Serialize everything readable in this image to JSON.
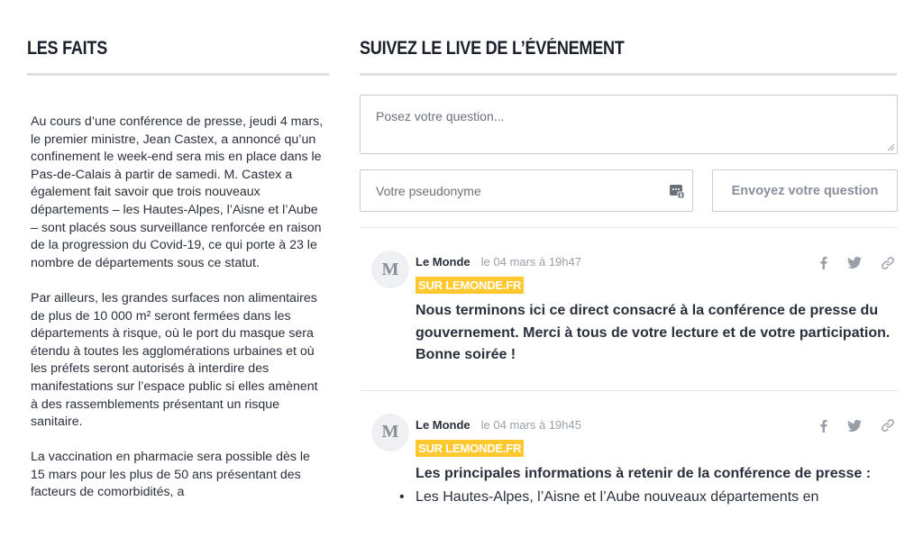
{
  "facts": {
    "title": "LES FAITS",
    "paragraphs": [
      "Au cours d’une conférence de presse, jeudi 4 mars, le premier ministre, Jean Castex, a annoncé qu’un confinement le week-end sera mis en place dans le Pas-de-Calais à partir de samedi. M. Castex a également fait savoir que trois nouveaux départements – les Hautes-Alpes, l’Aisne et l’Aube – sont placés sous surveillance renforcée en raison de la progression du Covid-19, ce qui porte à 23 le nombre de départements sous ce statut.",
      "Par ailleurs, les grandes surfaces non alimentaires de plus de 10 000 m² seront fermées dans les départements à risque, où le port du masque sera étendu à toutes les agglomérations urbaines et où les préfets seront autorisés à interdire des manifestations sur l’espace public si elles amènent à des rassemblements présentant un risque sanitaire.",
      "La vaccination en pharmacie sera possible dès le 15 mars pour les plus de 50 ans présentant des facteurs de comorbidités, a"
    ]
  },
  "live": {
    "title": "SUIVEZ LE LIVE DE L’ÉVÉNEMENT",
    "question_placeholder": "Posez votre question...",
    "pseudo_placeholder": "Votre pseudonyme",
    "send_label": "Envoyez votre question"
  },
  "posts": [
    {
      "avatar": "M",
      "author": "Le Monde",
      "time": "le 04 mars à 19h47",
      "tag": "SUR LEMONDE.FR",
      "title": "Nous terminons ici ce direct consacré à la conférence de presse du gouvernement. Merci à tous de votre lecture et de votre participation. Bonne soirée !"
    },
    {
      "avatar": "M",
      "author": "Le Monde",
      "time": "le 04 mars à 19h45",
      "tag": "SUR LEMONDE.FR",
      "title": "Les principales informations à retenir de la conférence de presse :",
      "bullet": "Les Hautes-Alpes, l’Aisne et l’Aube nouveaux départements en"
    }
  ],
  "icons": {
    "facebook": "facebook-icon",
    "twitter": "twitter-icon",
    "link": "link-icon",
    "password_manager": "password-manager-icon"
  },
  "colors": {
    "tag_bg": "#ffc82e",
    "text": "#2a303b",
    "muted": "#9aa0a8",
    "border": "#c8cbd0"
  }
}
